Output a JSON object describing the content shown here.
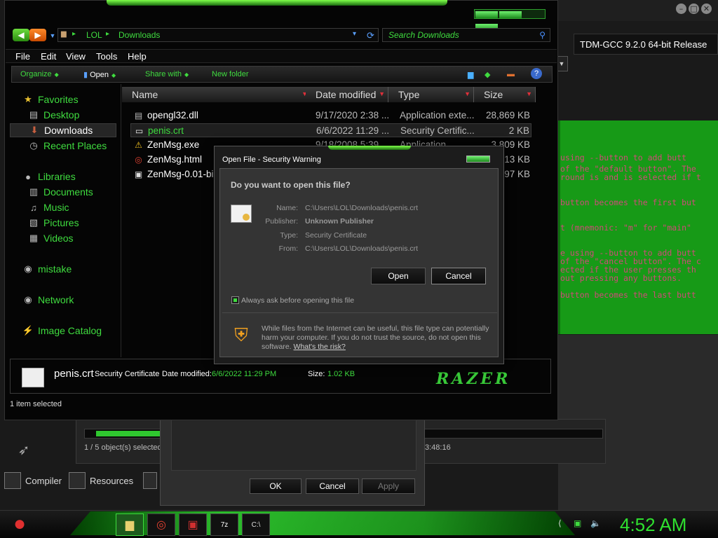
{
  "background": {
    "tdm_title": "TDM-GCC 9.2.0 64-bit Release",
    "console_lines": [
      "using --button to add butt",
      "of the \"default button\". The",
      "round is and is selected if t",
      "button becomes the first but",
      "t (mnemonic: \"m\" for \"main\"",
      "e using --button to add butt",
      "of the \"cancel button\". The c",
      "ected if the user presses th",
      "out pressing any buttons.",
      "button becomes the last butt"
    ],
    "devcpp_status": "1 / 5 object(s) selected",
    "devcpp_time": "3:48:16",
    "devcpp_progress": 0.65,
    "tabs": [
      {
        "label": "Compiler"
      },
      {
        "label": "Resources"
      }
    ],
    "props_dialog": {
      "ok": "OK",
      "cancel": "Cancel",
      "apply": "Apply"
    }
  },
  "explorer": {
    "breadcrumb": [
      "LOL",
      "Downloads"
    ],
    "search_placeholder": "Search Downloads",
    "menu": [
      "File",
      "Edit",
      "View",
      "Tools",
      "Help"
    ],
    "commands": {
      "organize": "Organize",
      "open": "Open",
      "share_with": "Share with",
      "new_folder": "New folder"
    },
    "sidebar": [
      {
        "label": "Favorites",
        "icon": "star-icon",
        "type": "group"
      },
      {
        "label": "Desktop",
        "icon": "desktop-icon",
        "type": "item"
      },
      {
        "label": "Downloads",
        "icon": "downloads-icon",
        "type": "item",
        "selected": true
      },
      {
        "label": "Recent Places",
        "icon": "recent-places-icon",
        "type": "item"
      },
      {
        "label": "Libraries",
        "icon": "libraries-icon",
        "type": "group"
      },
      {
        "label": "Documents",
        "icon": "documents-icon",
        "type": "item"
      },
      {
        "label": "Music",
        "icon": "music-icon",
        "type": "item"
      },
      {
        "label": "Pictures",
        "icon": "pictures-icon",
        "type": "item"
      },
      {
        "label": "Videos",
        "icon": "videos-icon",
        "type": "item"
      },
      {
        "label": "mistake",
        "icon": "homegroup-icon",
        "type": "group"
      },
      {
        "label": "Network",
        "icon": "network-icon",
        "type": "group"
      },
      {
        "label": "Image Catalog",
        "icon": "image-catalog-icon",
        "type": "group"
      }
    ],
    "columns": [
      "Name",
      "Date modified",
      "Type",
      "Size"
    ],
    "files": [
      {
        "name": "opengl32.dll",
        "date": "9/17/2020 2:38 ...",
        "type": "Application exte...",
        "size": "28,869 KB",
        "icon": "dll-icon"
      },
      {
        "name": "penis.crt",
        "date": "6/6/2022 11:29 ...",
        "type": "Security Certific...",
        "size": "2 KB",
        "icon": "certificate-icon",
        "selected": true
      },
      {
        "name": "ZenMsg.exe",
        "date": "9/18/2008 5:39 ...",
        "type": "Application",
        "size": "3,809 KB",
        "icon": "warning-exe-icon"
      },
      {
        "name": "ZenMsg.html",
        "date": "",
        "type": "",
        "size": "13 KB",
        "icon": "chrome-icon"
      },
      {
        "name": "ZenMsg-0.01-bin",
        "date": "",
        "type": "",
        "size": "97 KB",
        "icon": "archive-icon"
      }
    ],
    "details": {
      "name": "penis.crt",
      "type": "Security Certificate",
      "date_label": "Date modified:",
      "date_value": "6/6/2022 11:29 PM",
      "size_label": "Size:",
      "size_value": "1.02 KB",
      "logo": "RAZER"
    },
    "status": "1 item selected"
  },
  "security_dialog": {
    "title": "Open File - Security Warning",
    "question": "Do you want to open this file?",
    "fields": [
      {
        "label": "Name:",
        "value": "C:\\Users\\LOL\\Downloads\\penis.crt",
        "bold": false
      },
      {
        "label": "Publisher:",
        "value": "Unknown Publisher",
        "bold": true
      },
      {
        "label": "Type:",
        "value": "Security Certificate",
        "bold": false
      },
      {
        "label": "From:",
        "value": "C:\\Users\\LOL\\Downloads\\penis.crt",
        "bold": false
      }
    ],
    "open": "Open",
    "cancel": "Cancel",
    "always_ask": "Always ask before opening this file",
    "always_ask_checked": true,
    "warning": "While files from the Internet can be useful, this file type can potentially harm your computer. If you do not trust the source, do not open this software.",
    "risk_link": "What's the risk?"
  },
  "taskbar": {
    "buttons": [
      {
        "name": "explorer-taskbar-button",
        "icon": "folder-icon",
        "active": true
      },
      {
        "name": "chrome-taskbar-button",
        "icon": "chrome-icon",
        "active": false
      },
      {
        "name": "devcpp-taskbar-button",
        "icon": "devcpp-icon",
        "active": false
      },
      {
        "name": "7zip-taskbar-button",
        "icon": "7zip-icon",
        "active": false
      },
      {
        "name": "cmd-taskbar-button",
        "icon": "terminal-icon",
        "active": false
      }
    ],
    "clock": "4:52 AM"
  },
  "colors": {
    "accent_green": "#3fdc3f",
    "console_green": "#179a17",
    "warning_orange": "#f0a020"
  }
}
